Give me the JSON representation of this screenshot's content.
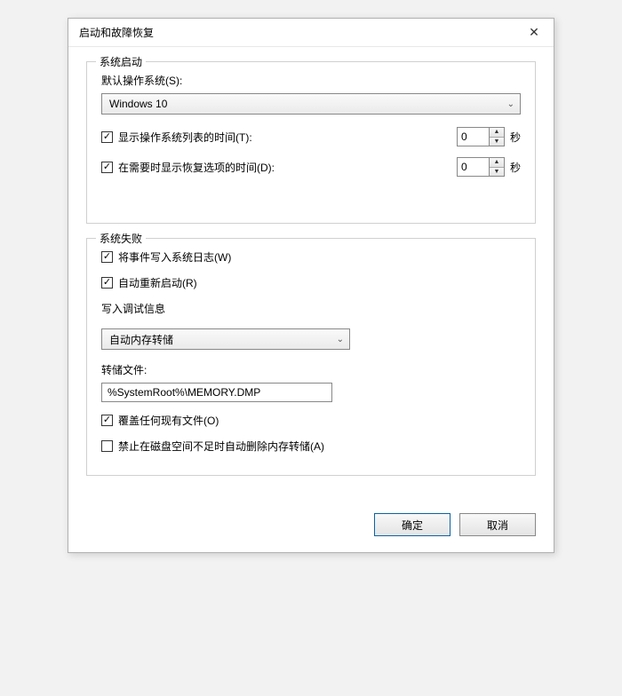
{
  "titlebar": {
    "title": "启动和故障恢复",
    "close_glyph": "✕"
  },
  "startup": {
    "group_title": "系统启动",
    "default_os_label": "默认操作系统(S):",
    "default_os_value": "Windows 10",
    "show_list_label": "显示操作系统列表的时间(T):",
    "show_list_checked": true,
    "show_list_value": "0",
    "recovery_time_label": "在需要时显示恢复选项的时间(D):",
    "recovery_time_checked": true,
    "recovery_time_value": "0",
    "seconds_unit": "秒"
  },
  "failure": {
    "group_title": "系统失败",
    "write_event_label": "将事件写入系统日志(W)",
    "write_event_checked": true,
    "auto_restart_label": "自动重新启动(R)",
    "auto_restart_checked": true,
    "debug_info_label": "写入调试信息",
    "debug_info_value": "自动内存转储",
    "dump_file_label": "转储文件:",
    "dump_file_value": "%SystemRoot%\\MEMORY.DMP",
    "overwrite_label": "覆盖任何现有文件(O)",
    "overwrite_checked": true,
    "disable_delete_label": "禁止在磁盘空间不足时自动删除内存转储(A)",
    "disable_delete_checked": false
  },
  "buttons": {
    "ok": "确定",
    "cancel": "取消"
  },
  "glyphs": {
    "check": "✓",
    "dropdown": "⌄",
    "up": "▲",
    "down": "▼"
  }
}
